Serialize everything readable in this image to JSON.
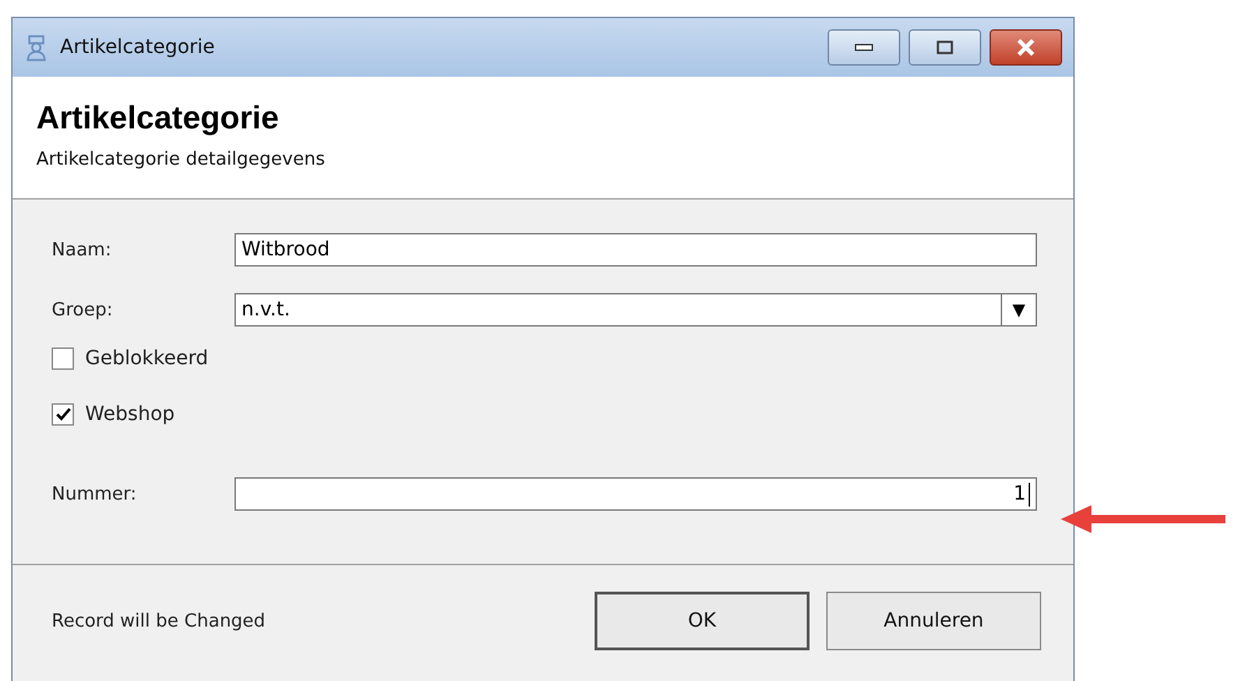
{
  "window": {
    "title": "Artikelcategorie"
  },
  "header": {
    "title": "Artikelcategorie",
    "subtitle": "Artikelcategorie detailgegevens"
  },
  "fields": [
    {
      "kind": "text",
      "label": "Naam:",
      "value": "Witbrood"
    },
    {
      "kind": "dropdown",
      "label": "Groep:",
      "value": "n.v.t.",
      "arrow": "▼"
    }
  ],
  "checkboxes": [
    {
      "label": "Geblokkeerd",
      "checked": false
    },
    {
      "label": "Webshop",
      "checked": true
    }
  ],
  "number_field": {
    "label": "Nummer:",
    "value": "1"
  },
  "status": "Record will be Changed",
  "buttons": [
    {
      "label": "OK",
      "default": true
    },
    {
      "label": "Annuleren",
      "default": false
    }
  ]
}
